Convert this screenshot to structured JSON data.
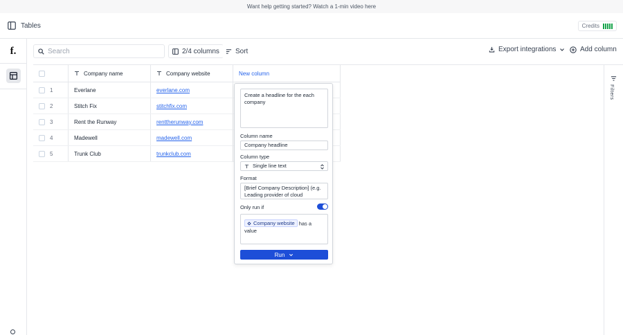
{
  "banner": {
    "text": "Want help getting started? Watch a 1-min video here"
  },
  "topbar": {
    "title": "Tables",
    "credits_label": "Credits"
  },
  "toolbar": {
    "search_placeholder": "Search",
    "columns_label": "2/4 columns",
    "sort_label": "Sort",
    "export_label": "Export integrations",
    "add_column_label": "Add column"
  },
  "table": {
    "headers": [
      "Company name",
      "Company website",
      "New column"
    ],
    "rows": [
      {
        "num": "1",
        "name": "Everlane",
        "website": "everlane.com"
      },
      {
        "num": "2",
        "name": "Stitch Fix",
        "website": "stitchfix.com"
      },
      {
        "num": "3",
        "name": "Rent the Runway",
        "website": "renttherunway.com"
      },
      {
        "num": "4",
        "name": "Madewell",
        "website": "madewell.com"
      },
      {
        "num": "5",
        "name": "Trunk Club",
        "website": "trunkclub.com"
      }
    ]
  },
  "filters": {
    "label": "Filters"
  },
  "popup": {
    "prompt": "Create a headline for the each company",
    "column_name_label": "Column name",
    "column_name_value": "Company headline",
    "column_type_label": "Column type",
    "column_type_value": "Single line text",
    "format_label": "Format",
    "format_value": "[Brief Company Description] (e.g. Leading provider of cloud computing solutions)",
    "only_run_if_label": "Only run if",
    "condition_chip": "Company website",
    "condition_text": "has a value",
    "run_label": "Run"
  }
}
